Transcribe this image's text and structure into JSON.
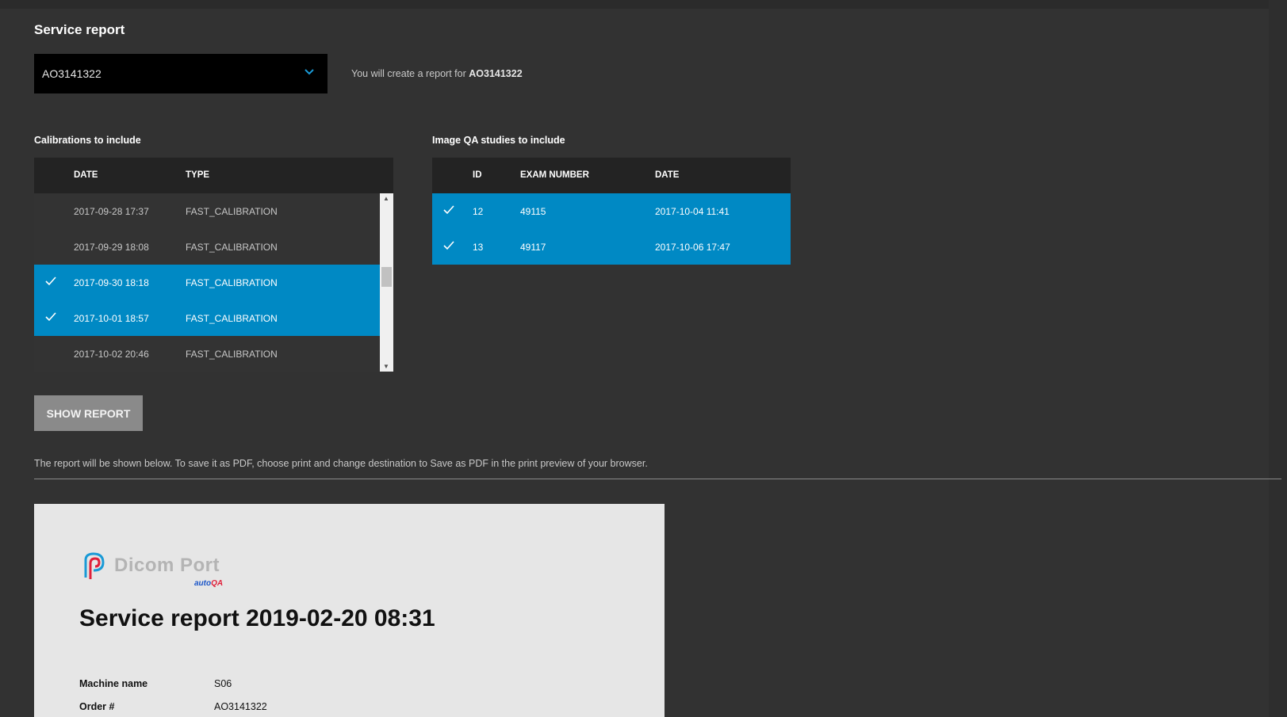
{
  "page": {
    "title": "Service report",
    "hint_prefix": "You will create a report for",
    "note": "The report will be shown below. To save it as PDF, choose print and change destination to Save as PDF in the print preview of your browser.",
    "show_button": "SHOW REPORT"
  },
  "machine_select": {
    "value": "AO3141322",
    "icon": "chevron-down-icon"
  },
  "calibrations": {
    "label": "Calibrations to include",
    "columns": [
      "DATE",
      "TYPE"
    ],
    "rows": [
      {
        "date": "2017-09-28 17:37",
        "type": "FAST_CALIBRATION",
        "selected": false
      },
      {
        "date": "2017-09-29 18:08",
        "type": "FAST_CALIBRATION",
        "selected": false
      },
      {
        "date": "2017-09-30 18:18",
        "type": "FAST_CALIBRATION",
        "selected": true
      },
      {
        "date": "2017-10-01 18:57",
        "type": "FAST_CALIBRATION",
        "selected": true
      },
      {
        "date": "2017-10-02 20:46",
        "type": "FAST_CALIBRATION",
        "selected": false
      }
    ]
  },
  "image_qa": {
    "label": "Image QA studies to include",
    "columns": [
      "ID",
      "EXAM NUMBER",
      "DATE"
    ],
    "rows": [
      {
        "id": "12",
        "exam": "49115",
        "date": "2017-10-04 11:41",
        "selected": true
      },
      {
        "id": "13",
        "exam": "49117",
        "date": "2017-10-06 17:47",
        "selected": true
      }
    ]
  },
  "report": {
    "logo_text": "Dicom Port",
    "logo_sub_a": "auto",
    "logo_sub_b": "QA",
    "title": "Service report 2019-02-20 08:31",
    "fields": [
      {
        "label": "Machine name",
        "value": "S06"
      },
      {
        "label": "Order #",
        "value": "AO3141322"
      }
    ]
  },
  "colors": {
    "accent": "#0089c4",
    "background": "#323232",
    "panel": "#e6e6e6"
  }
}
